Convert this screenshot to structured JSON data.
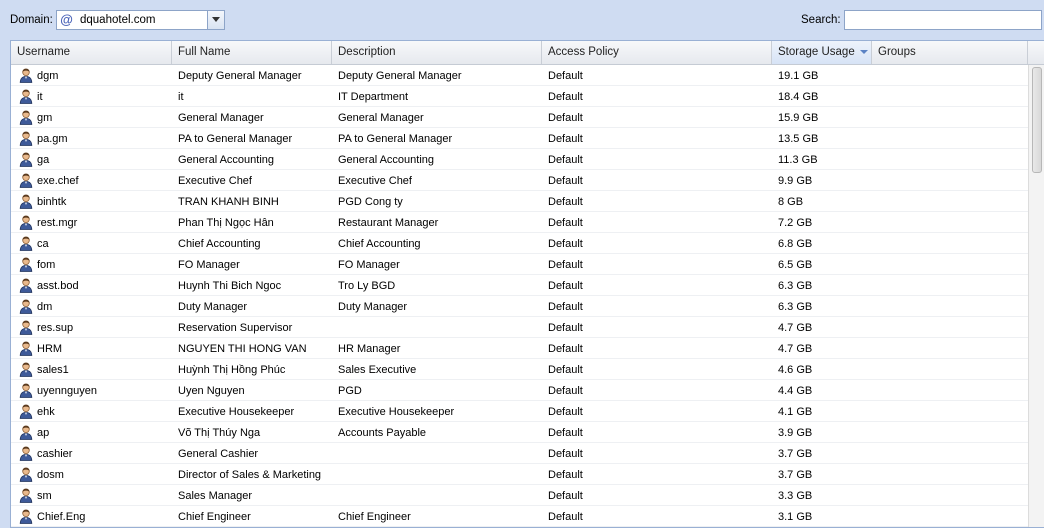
{
  "toolbar": {
    "domain_label": "Domain:",
    "domain_value": "dquahotel.com",
    "search_label": "Search:",
    "search_value": ""
  },
  "columns": [
    "Username",
    "Full Name",
    "Description",
    "Access Policy",
    "Storage Usage",
    "Groups"
  ],
  "sorted_column": "Storage Usage",
  "sort_direction": "descending",
  "accent_color": "#5b82c4",
  "rows": [
    {
      "username": "dgm",
      "full_name": "Deputy General Manager",
      "description": "Deputy General Manager",
      "policy": "Default",
      "storage": "19.1 GB",
      "groups": ""
    },
    {
      "username": "it",
      "full_name": "it",
      "description": "IT Department",
      "policy": "Default",
      "storage": "18.4 GB",
      "groups": ""
    },
    {
      "username": "gm",
      "full_name": "General Manager",
      "description": "General Manager",
      "policy": "Default",
      "storage": "15.9 GB",
      "groups": ""
    },
    {
      "username": "pa.gm",
      "full_name": "PA to General Manager",
      "description": "PA to General Manager",
      "policy": "Default",
      "storage": "13.5 GB",
      "groups": ""
    },
    {
      "username": "ga",
      "full_name": "General Accounting",
      "description": "General Accounting",
      "policy": "Default",
      "storage": "11.3 GB",
      "groups": ""
    },
    {
      "username": "exe.chef",
      "full_name": "Executive Chef",
      "description": "Executive Chef",
      "policy": "Default",
      "storage": "9.9 GB",
      "groups": ""
    },
    {
      "username": "binhtk",
      "full_name": "TRAN KHANH BINH",
      "description": "PGD Cong ty",
      "policy": "Default",
      "storage": "8 GB",
      "groups": ""
    },
    {
      "username": "rest.mgr",
      "full_name": "Phan Thị Ngọc Hân",
      "description": "Restaurant Manager",
      "policy": "Default",
      "storage": "7.2 GB",
      "groups": ""
    },
    {
      "username": "ca",
      "full_name": "Chief Accounting",
      "description": "Chief Accounting",
      "policy": "Default",
      "storage": "6.8 GB",
      "groups": ""
    },
    {
      "username": "fom",
      "full_name": "FO Manager",
      "description": "FO Manager",
      "policy": "Default",
      "storage": "6.5 GB",
      "groups": ""
    },
    {
      "username": "asst.bod",
      "full_name": "Huynh Thi Bich Ngoc",
      "description": "Tro Ly BGD",
      "policy": "Default",
      "storage": "6.3 GB",
      "groups": ""
    },
    {
      "username": "dm",
      "full_name": "Duty Manager",
      "description": "Duty Manager",
      "policy": "Default",
      "storage": "6.3 GB",
      "groups": ""
    },
    {
      "username": "res.sup",
      "full_name": "Reservation Supervisor",
      "description": "",
      "policy": "Default",
      "storage": "4.7 GB",
      "groups": ""
    },
    {
      "username": "HRM",
      "full_name": "NGUYEN THI HONG VAN",
      "description": "HR Manager",
      "policy": "Default",
      "storage": "4.7 GB",
      "groups": ""
    },
    {
      "username": "sales1",
      "full_name": "Huỳnh Thị Hồng Phúc",
      "description": "Sales Executive",
      "policy": "Default",
      "storage": "4.6 GB",
      "groups": ""
    },
    {
      "username": "uyennguyen",
      "full_name": "Uyen Nguyen",
      "description": "PGD",
      "policy": "Default",
      "storage": "4.4 GB",
      "groups": ""
    },
    {
      "username": "ehk",
      "full_name": "Executive Housekeeper",
      "description": "Executive Housekeeper",
      "policy": "Default",
      "storage": "4.1 GB",
      "groups": ""
    },
    {
      "username": "ap",
      "full_name": "Võ Thị Thúy Nga",
      "description": "Accounts Payable",
      "policy": "Default",
      "storage": "3.9 GB",
      "groups": ""
    },
    {
      "username": "cashier",
      "full_name": "General Cashier",
      "description": "",
      "policy": "Default",
      "storage": "3.7 GB",
      "groups": ""
    },
    {
      "username": "dosm",
      "full_name": "Director of Sales & Marketing",
      "description": "",
      "policy": "Default",
      "storage": "3.7 GB",
      "groups": ""
    },
    {
      "username": "sm",
      "full_name": "Sales Manager",
      "description": "",
      "policy": "Default",
      "storage": "3.3 GB",
      "groups": ""
    },
    {
      "username": "Chief.Eng",
      "full_name": "Chief Engineer",
      "description": "Chief Engineer",
      "policy": "Default",
      "storage": "3.1 GB",
      "groups": ""
    }
  ]
}
